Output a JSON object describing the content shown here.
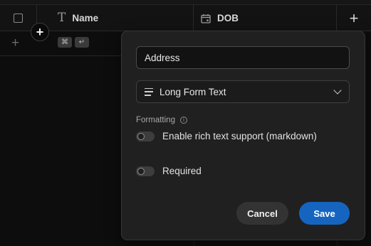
{
  "header": {
    "columns": [
      {
        "label": "Name",
        "icon": "text-type-icon"
      },
      {
        "label": "DOB",
        "icon": "calendar-icon"
      }
    ]
  },
  "row": {
    "shortcut_keys": [
      "⌘",
      "↵"
    ]
  },
  "popover": {
    "field_name_value": "Address",
    "field_type_value": "Long Form Text",
    "formatting_label": "Formatting",
    "rich_text_label": "Enable rich text support (markdown)",
    "rich_text_enabled": false,
    "required_label": "Required",
    "required_enabled": false,
    "cancel_label": "Cancel",
    "save_label": "Save"
  },
  "colors": {
    "accent": "#1565c0",
    "background": "#0d0d0d",
    "popover": "#202020"
  }
}
